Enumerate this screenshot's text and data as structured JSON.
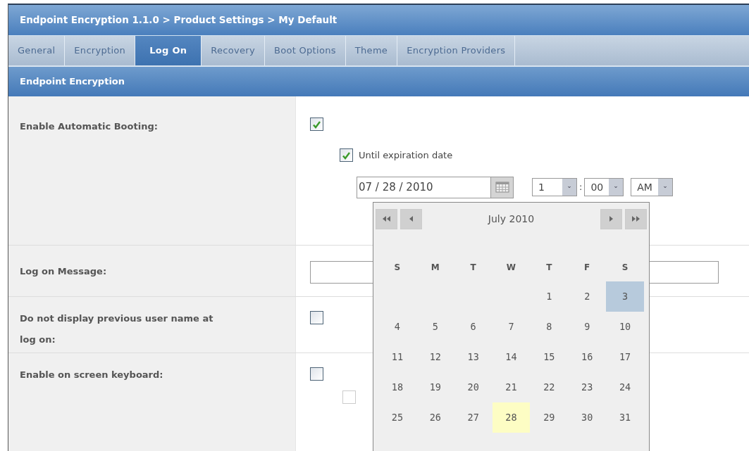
{
  "breadcrumb": "Endpoint Encryption 1.1.0 > Product Settings > My Default",
  "tabs": [
    {
      "label": "General",
      "selected": false
    },
    {
      "label": "Encryption",
      "selected": false
    },
    {
      "label": "Log On",
      "selected": true
    },
    {
      "label": "Recovery",
      "selected": false
    },
    {
      "label": "Boot Options",
      "selected": false
    },
    {
      "label": "Theme",
      "selected": false
    },
    {
      "label": "Encryption Providers",
      "selected": false
    }
  ],
  "section_title": "Endpoint Encryption",
  "settings": [
    {
      "kind": "autoboot",
      "label": "Enable Automatic Booting:",
      "checked": true,
      "until": {
        "label": "Until expiration date",
        "checked": true
      },
      "date": "07 / 28 / 2010",
      "hour": "1",
      "minute": "00",
      "time_separator": ":",
      "ampm": "AM"
    },
    {
      "kind": "text",
      "label": "Log on Message:"
    },
    {
      "kind": "checkbox",
      "label": "Do not display previous user name at log on:",
      "checked": false
    },
    {
      "kind": "keyboard",
      "label": "Enable on screen keyboard:",
      "checked": false,
      "sub_disabled": true
    }
  ],
  "calendar": {
    "title": "July 2010",
    "weekdays": [
      "S",
      "M",
      "T",
      "W",
      "T",
      "F",
      "S"
    ],
    "weeks": [
      [
        {
          "label": "1",
          "selected": false,
          "hovered": false
        },
        {
          "label": "2",
          "selected": false,
          "hovered": false
        },
        {
          "label": "3",
          "selected": false,
          "hovered": true
        }
      ],
      [
        {
          "label": "4",
          "selected": false,
          "hovered": false
        },
        {
          "label": "5",
          "selected": false,
          "hovered": false
        },
        {
          "label": "6",
          "selected": false,
          "hovered": false
        },
        {
          "label": "7",
          "selected": false,
          "hovered": false
        },
        {
          "label": "8",
          "selected": false,
          "hovered": false
        },
        {
          "label": "9",
          "selected": false,
          "hovered": false
        },
        {
          "label": "10",
          "selected": false,
          "hovered": false
        }
      ],
      [
        {
          "label": "11",
          "selected": false,
          "hovered": false
        },
        {
          "label": "12",
          "selected": false,
          "hovered": false
        },
        {
          "label": "13",
          "selected": false,
          "hovered": false
        },
        {
          "label": "14",
          "selected": false,
          "hovered": false
        },
        {
          "label": "15",
          "selected": false,
          "hovered": false
        },
        {
          "label": "16",
          "selected": false,
          "hovered": false
        },
        {
          "label": "17",
          "selected": false,
          "hovered": false
        }
      ],
      [
        {
          "label": "18",
          "selected": false,
          "hovered": false
        },
        {
          "label": "19",
          "selected": false,
          "hovered": false
        },
        {
          "label": "20",
          "selected": false,
          "hovered": false
        },
        {
          "label": "21",
          "selected": false,
          "hovered": false
        },
        {
          "label": "22",
          "selected": false,
          "hovered": false
        },
        {
          "label": "23",
          "selected": false,
          "hovered": false
        },
        {
          "label": "24",
          "selected": false,
          "hovered": false
        }
      ],
      [
        {
          "label": "25",
          "selected": false,
          "hovered": false
        },
        {
          "label": "26",
          "selected": false,
          "hovered": false
        },
        {
          "label": "27",
          "selected": false,
          "hovered": false
        },
        {
          "label": "28",
          "selected": true,
          "hovered": false
        },
        {
          "label": "29",
          "selected": false,
          "hovered": false
        },
        {
          "label": "30",
          "selected": false,
          "hovered": false
        },
        {
          "label": "31",
          "selected": false,
          "hovered": false
        }
      ]
    ]
  }
}
